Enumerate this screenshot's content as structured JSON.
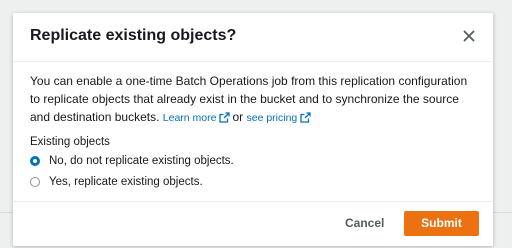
{
  "modal": {
    "title": "Replicate existing objects?",
    "description": "You can enable a one-time Batch Operations job from this replication configuration to replicate objects that already exist in the bucket and to synchronize the source and destination buckets.",
    "learn_more_label": "Learn more",
    "or_text": "or",
    "see_pricing_label": "see pricing",
    "close_icon": "close-icon",
    "external_link_icon": "external-link-icon"
  },
  "existing_objects": {
    "label": "Existing objects",
    "options": [
      {
        "label": "No, do not replicate existing objects.",
        "selected": true
      },
      {
        "label": "Yes, replicate existing objects.",
        "selected": false
      }
    ]
  },
  "footer": {
    "cancel_label": "Cancel",
    "submit_label": "Submit"
  },
  "colors": {
    "primary_button": "#ec7211",
    "link": "#0073bb",
    "radio_selected": "#0073bb"
  }
}
